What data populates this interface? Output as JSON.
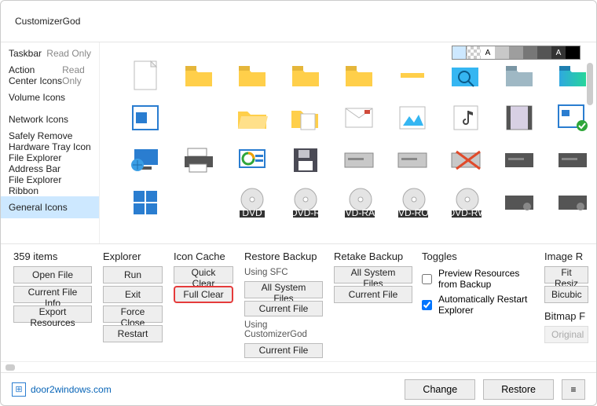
{
  "app": {
    "title": "CustomizerGod"
  },
  "sidebar": {
    "items": [
      {
        "label": "Taskbar",
        "ro": "Read Only"
      },
      {
        "label": "Action Center Icons",
        "ro": "Read Only"
      },
      {
        "label": "Volume Icons"
      },
      {
        "label": "Network Icons"
      },
      {
        "label": "Safely Remove Hardware Tray Icon"
      },
      {
        "label": "File Explorer Address Bar"
      },
      {
        "label": "File Explorer Ribbon"
      },
      {
        "label": "General Icons"
      }
    ],
    "selected": 7
  },
  "swatches": [
    "checker",
    "A",
    "dkA",
    "lgrey",
    "grey",
    "dkgrey",
    "Awht",
    "black"
  ],
  "panel": {
    "count": "359 items",
    "open_file": "Open File",
    "current_file_info": "Current File Info",
    "export_resources": "Export Resources",
    "explorer": "Explorer",
    "run": "Run",
    "exit": "Exit",
    "force_close": "Force Close",
    "restart": "Restart",
    "icon_cache": "Icon Cache",
    "quick_clear": "Quick Clear",
    "full_clear": "Full Clear",
    "restore_backup": "Restore Backup",
    "using_sfc": "Using SFC",
    "all_system_files": "All System Files",
    "current_file": "Current File",
    "using_cgod": "Using CustomizerGod",
    "retake_backup": "Retake Backup",
    "toggles": "Toggles",
    "toggle1": "Preview Resources from Backup",
    "toggle2": "Automatically Restart Explorer",
    "toggle2_checked": true,
    "image_r": "Image R",
    "fit_resiz": "Fit Resiz",
    "bicubic": "Bicubic",
    "bitmap": "Bitmap F",
    "original": "Original"
  },
  "footer": {
    "link": "door2windows.com",
    "change": "Change",
    "restore": "Restore"
  }
}
